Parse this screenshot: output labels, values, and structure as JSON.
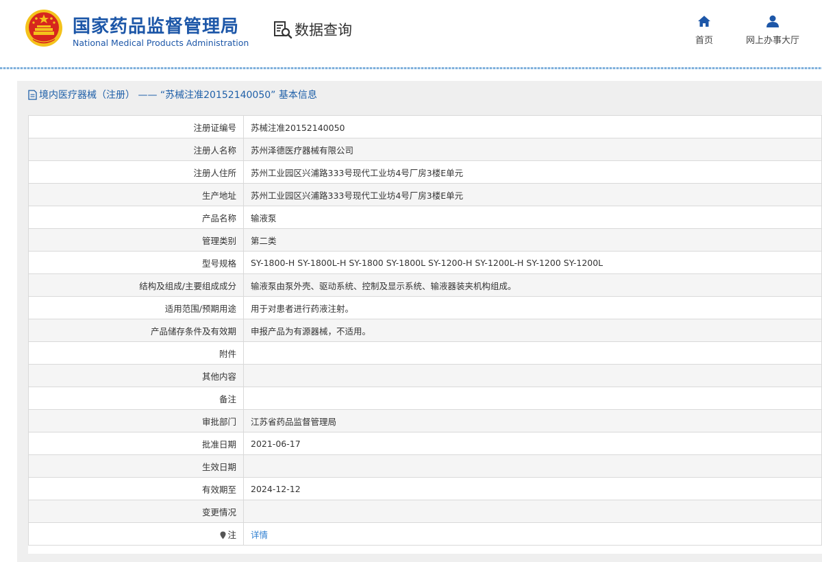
{
  "header": {
    "brand_cn": "国家药品监督管理局",
    "brand_en": "National Medical Products Administration",
    "query_title": "数据查询",
    "nav": {
      "home": "首页",
      "hall": "网上办事大厅"
    }
  },
  "panel": {
    "title": "境内医疗器械（注册） ——  “苏械注准20152140050” 基本信息"
  },
  "rows": [
    {
      "label": "注册证编号",
      "value": "苏械注准20152140050"
    },
    {
      "label": "注册人名称",
      "value": "苏州泽德医疗器械有限公司"
    },
    {
      "label": "注册人住所",
      "value": "苏州工业园区兴浦路333号现代工业坊4号厂房3楼E单元"
    },
    {
      "label": "生产地址",
      "value": "苏州工业园区兴浦路333号现代工业坊4号厂房3楼E单元"
    },
    {
      "label": "产品名称",
      "value": "输液泵"
    },
    {
      "label": "管理类别",
      "value": "第二类"
    },
    {
      "label": "型号规格",
      "value": "SY-1800-H SY-1800L-H SY-1800 SY-1800L SY-1200-H SY-1200L-H SY-1200 SY-1200L"
    },
    {
      "label": "结构及组成/主要组成成分",
      "value": "输液泵由泵外壳、驱动系统、控制及显示系统、输液器装夹机构组成。"
    },
    {
      "label": "适用范围/预期用途",
      "value": "用于对患者进行药液注射。"
    },
    {
      "label": "产品储存条件及有效期",
      "value": "申报产品为有源器械，不适用。"
    },
    {
      "label": "附件",
      "value": ""
    },
    {
      "label": "其他内容",
      "value": ""
    },
    {
      "label": "备注",
      "value": ""
    },
    {
      "label": "审批部门",
      "value": "江苏省药品监督管理局"
    },
    {
      "label": "批准日期",
      "value": "2021-06-17"
    },
    {
      "label": "生效日期",
      "value": ""
    },
    {
      "label": "有效期至",
      "value": "2024-12-12"
    },
    {
      "label": "变更情况",
      "value": ""
    }
  ],
  "note_row": {
    "label": "注",
    "link": "详情"
  },
  "colors": {
    "brand_blue": "#1d57a8",
    "link_blue": "#2f7fd1",
    "emblem_red": "#d7261e",
    "emblem_gold": "#f4c21b"
  },
  "icons": {
    "emblem": "national-emblem-icon",
    "query": "search-document-icon",
    "home": "home-icon",
    "hall": "user-icon",
    "title": "document-icon",
    "note": "pin-icon"
  }
}
